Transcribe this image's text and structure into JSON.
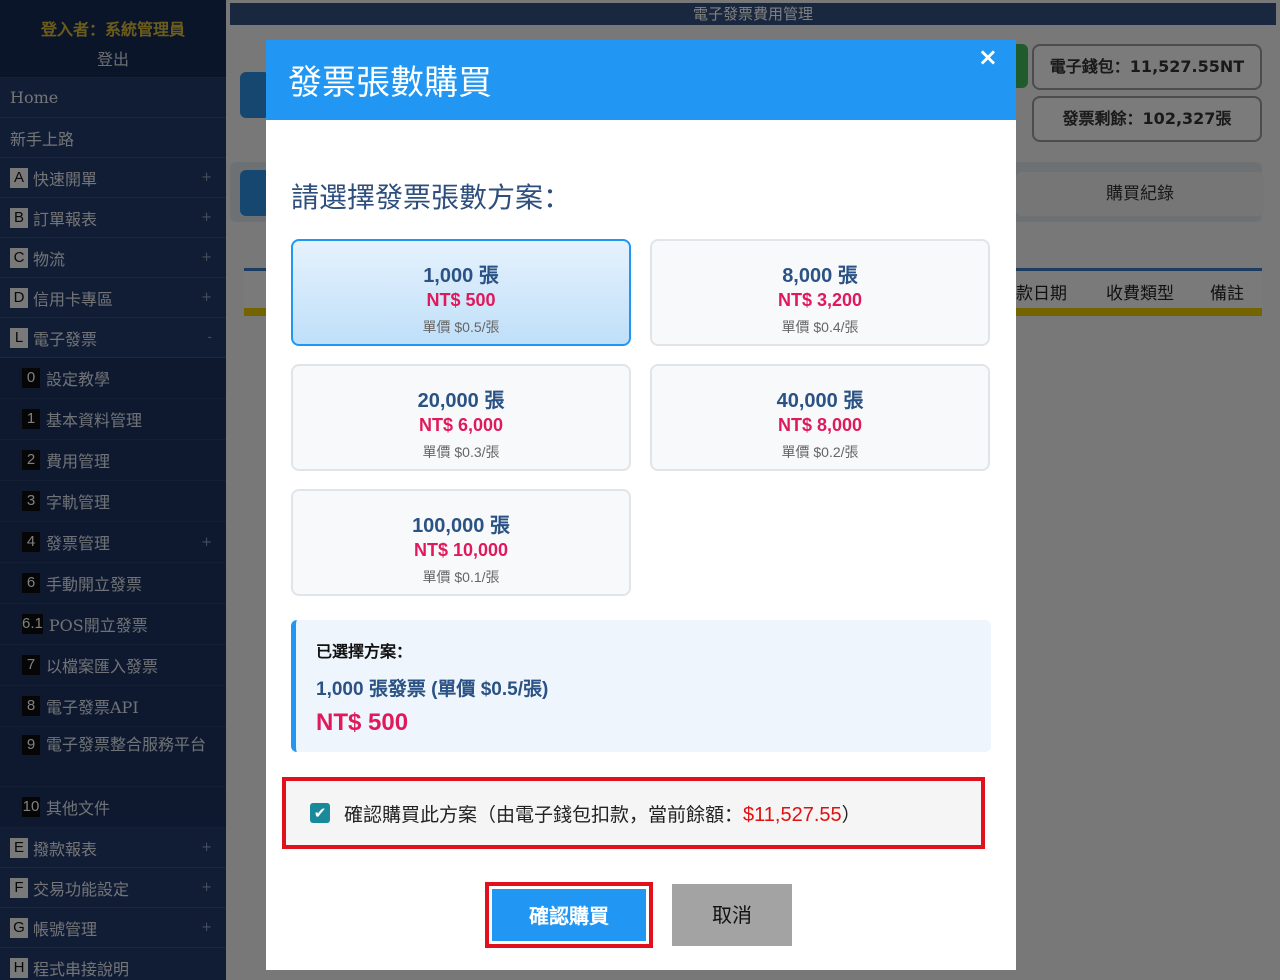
{
  "sidebar": {
    "user_label": "登入者：系統管理員",
    "logout": "登出",
    "home": "Home",
    "guide": "新手上路",
    "items_top": [
      {
        "badge": "A",
        "label": "快速開單",
        "pm": "+"
      },
      {
        "badge": "B",
        "label": "訂單報表",
        "pm": "+"
      },
      {
        "badge": "C",
        "label": "物流",
        "pm": "+"
      },
      {
        "badge": "D",
        "label": "信用卡專區",
        "pm": "+"
      },
      {
        "badge": "L",
        "label": "電子發票",
        "pm": "-"
      }
    ],
    "sub_items": [
      {
        "badge": "0",
        "label": "設定教學",
        "pm": ""
      },
      {
        "badge": "1",
        "label": "基本資料管理",
        "pm": ""
      },
      {
        "badge": "2",
        "label": "費用管理",
        "pm": ""
      },
      {
        "badge": "3",
        "label": "字軌管理",
        "pm": ""
      },
      {
        "badge": "4",
        "label": "發票管理",
        "pm": "+"
      },
      {
        "badge": "6",
        "label": "手動開立發票",
        "pm": ""
      },
      {
        "badge": "6.1",
        "label": "POS開立發票",
        "pm": ""
      },
      {
        "badge": "7",
        "label": "以檔案匯入發票",
        "pm": ""
      },
      {
        "badge": "8",
        "label": "電子發票API",
        "pm": ""
      },
      {
        "badge": "9",
        "label": "電子發票整合服務平台",
        "pm": ""
      },
      {
        "badge": "10",
        "label": "其他文件",
        "pm": ""
      }
    ],
    "items_bottom": [
      {
        "badge": "E",
        "label": "撥款報表",
        "pm": "+"
      },
      {
        "badge": "F",
        "label": "交易功能設定",
        "pm": "+"
      },
      {
        "badge": "G",
        "label": "帳號管理",
        "pm": "+"
      },
      {
        "badge": "H",
        "label": "程式串接說明",
        "pm": ""
      }
    ]
  },
  "main": {
    "title": "電子發票費用管理",
    "wallet": "電子錢包：11,527.55NT",
    "remaining": "發票剩餘：102,327張",
    "tab_record": "購買紀錄",
    "columns": [
      "款日期",
      "收費類型",
      "備註"
    ]
  },
  "modal": {
    "title": "發票張數購買",
    "close": "×",
    "choose_prompt": "請選擇發票張數方案：",
    "plans": [
      {
        "qty": "1,000 張",
        "price": "NT$ 500",
        "unit": "單價 $0.5/張",
        "selected": true
      },
      {
        "qty": "8,000 張",
        "price": "NT$ 3,200",
        "unit": "單價 $0.4/張",
        "selected": false
      },
      {
        "qty": "20,000 張",
        "price": "NT$ 6,000",
        "unit": "單價 $0.3/張",
        "selected": false
      },
      {
        "qty": "40,000 張",
        "price": "NT$ 8,000",
        "unit": "單價 $0.2/張",
        "selected": false
      },
      {
        "qty": "100,000 張",
        "price": "NT$ 10,000",
        "unit": "單價 $0.1/張",
        "selected": false
      }
    ],
    "summary": {
      "label": "已選擇方案：",
      "desc": "1,000 張發票 (單價 $0.5/張)",
      "amount": "NT$ 500"
    },
    "confirm_checkbox": {
      "checked": true,
      "text": "確認購買此方案（由電子錢包扣款，當前餘額：",
      "balance": "$11,527.55",
      "suffix": "）"
    },
    "btn_confirm": "確認購買",
    "btn_cancel": "取消"
  }
}
